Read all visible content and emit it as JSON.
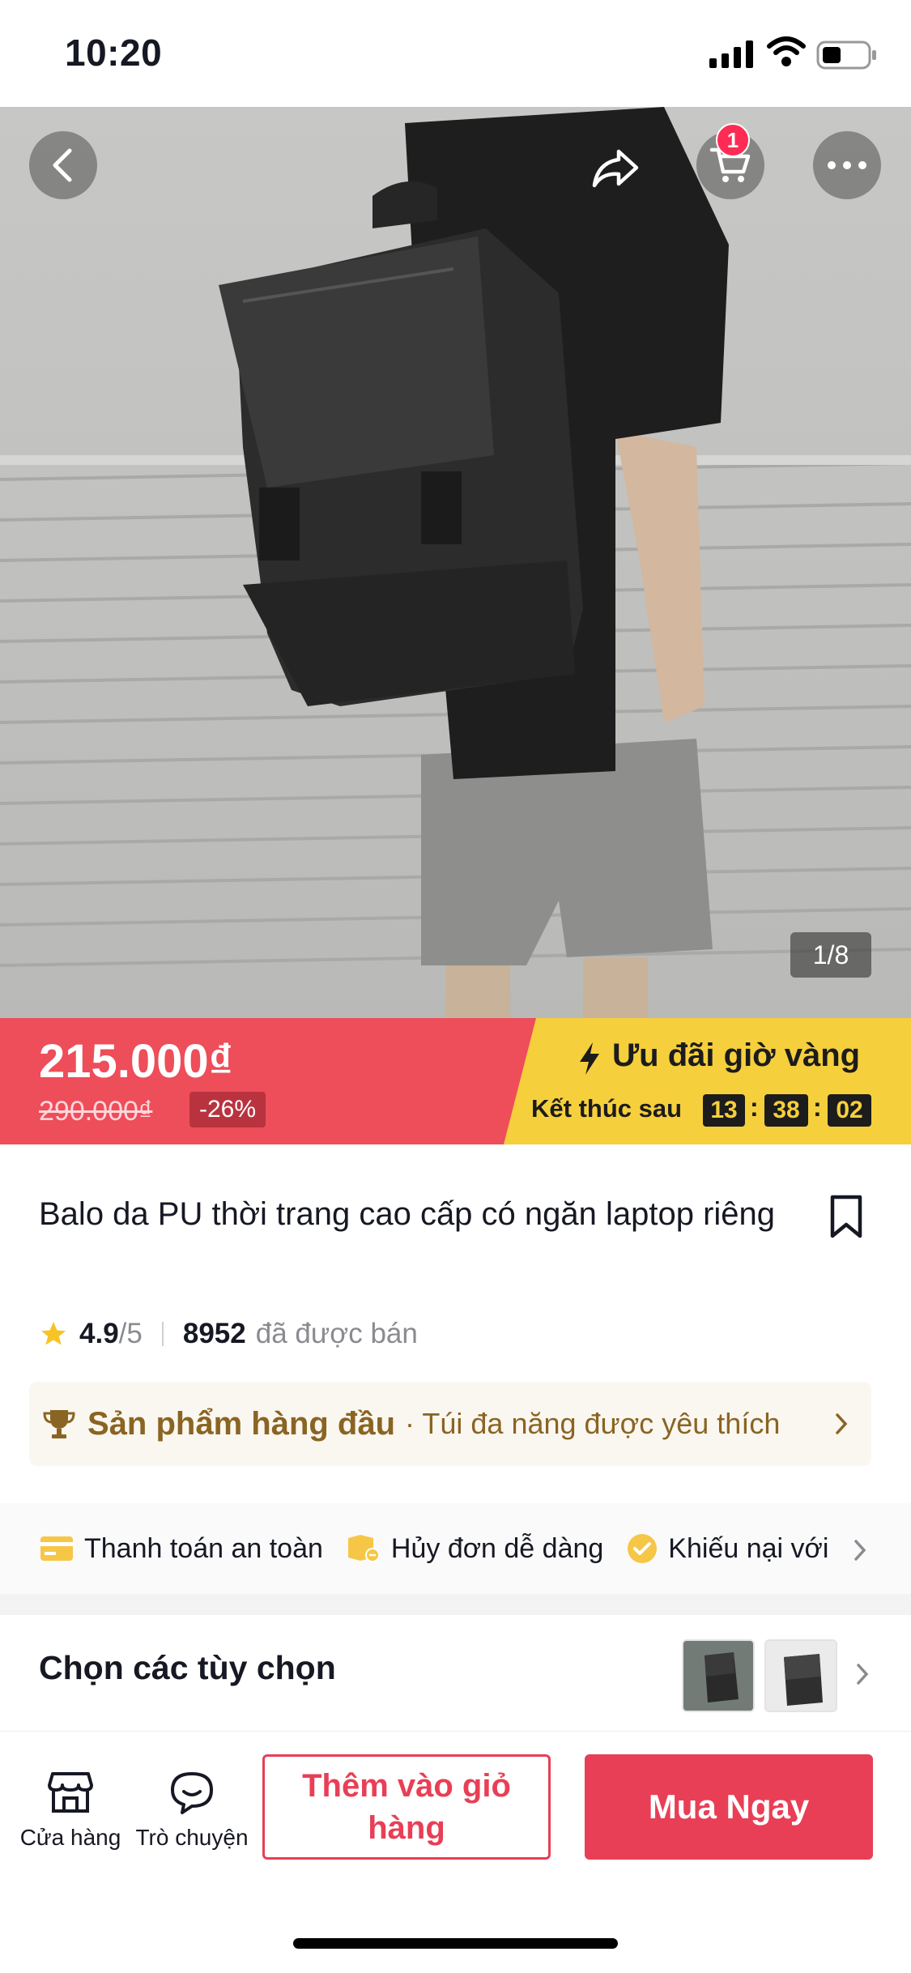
{
  "status_bar": {
    "time": "10:20"
  },
  "header": {
    "cart_count": "1"
  },
  "gallery": {
    "counter": "1/8"
  },
  "price": {
    "current": "215.000₫",
    "original": "290.000₫",
    "discount": "-26%"
  },
  "promo": {
    "title": "Ưu đãi giờ vàng",
    "ends_in_label": "Kết thúc sau",
    "hours": "13",
    "minutes": "38",
    "seconds": "02",
    "separator": ":"
  },
  "product": {
    "title": "Balo da PU thời trang cao cấp có ngăn laptop riêng",
    "rating": "4.9",
    "rating_max": "/5",
    "sold_count": "8952",
    "sold_label": "đã được bán"
  },
  "top_product": {
    "title": "Sản phẩm hàng đầu",
    "desc": "· Túi đa năng được yêu thích"
  },
  "guarantees": {
    "items": [
      "Thanh toán an toàn",
      "Hủy đơn dễ dàng",
      "Khiếu nại với"
    ]
  },
  "options": {
    "label": "Chọn các tùy chọn"
  },
  "bottom_bar": {
    "shop_label": "Cửa hàng",
    "chat_label": "Trò chuyện",
    "add_to_cart": "Thêm vào giỏ hàng",
    "buy_now": "Mua Ngay"
  },
  "colors": {
    "accent": "#e83f56",
    "price_banner": "#ee4d5a",
    "promo_yellow": "#f6cf3c",
    "top_product_text": "#8a6422"
  }
}
